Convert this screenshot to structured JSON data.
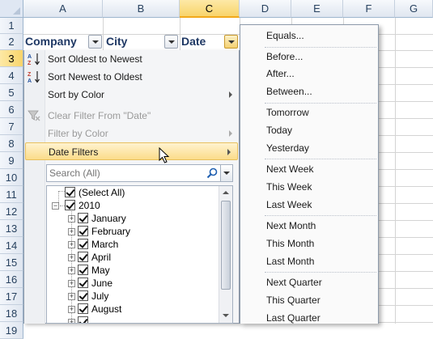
{
  "columns": [
    "A",
    "B",
    "C",
    "D",
    "E",
    "F",
    "G"
  ],
  "active_column": "C",
  "rows": [
    "1",
    "2",
    "3",
    "4",
    "5",
    "6",
    "7",
    "8",
    "9",
    "10",
    "11",
    "12",
    "13",
    "14",
    "15",
    "16",
    "17",
    "18",
    "19"
  ],
  "active_row": "3",
  "headers": {
    "company": "Company",
    "city": "City",
    "date": "Date"
  },
  "filter_menu": {
    "sort_oldest": "Sort Oldest to Newest",
    "sort_newest": "Sort Newest to Oldest",
    "sort_by_color": "Sort by Color",
    "clear_filter": "Clear Filter From \"Date\"",
    "filter_by_color": "Filter by Color",
    "date_filters": "Date Filters",
    "search_placeholder": "Search (All)",
    "tree": {
      "select_all": "(Select All)",
      "year": "2010",
      "months": [
        "January",
        "February",
        "March",
        "April",
        "May",
        "June",
        "July",
        "August"
      ]
    }
  },
  "date_filters_submenu": {
    "groups": [
      [
        "Equals..."
      ],
      [
        "Before...",
        "After...",
        "Between..."
      ],
      [
        "Tomorrow",
        "Today",
        "Yesterday"
      ],
      [
        "Next Week",
        "This Week",
        "Last Week"
      ],
      [
        "Next Month",
        "This Month",
        "Last Month"
      ],
      [
        "Next Quarter",
        "This Quarter",
        "Last Quarter"
      ]
    ]
  },
  "icons": {
    "sort_asc": "sort-a-to-z-icon",
    "sort_desc": "sort-z-to-a-icon",
    "clear_filter": "clear-filter-icon",
    "search": "magnifier-icon",
    "cursor": "mouse-pointer-icon"
  },
  "colors": {
    "header_text": "#1f3864",
    "hover_highlight": "#fbdc8a",
    "active_column_header": "#f8d46a"
  }
}
